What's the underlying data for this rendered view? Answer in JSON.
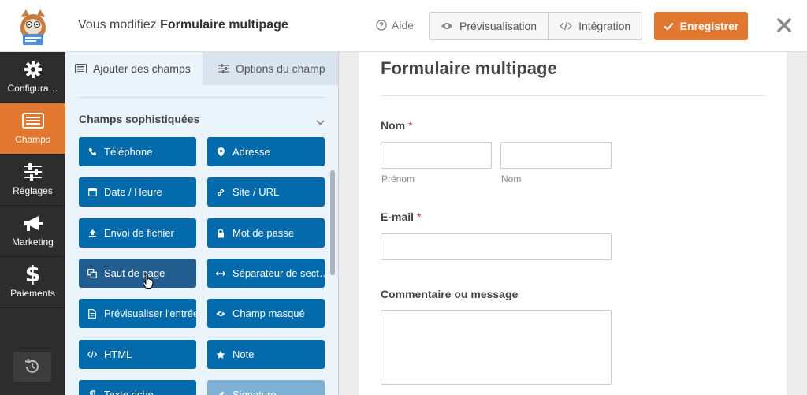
{
  "topbar": {
    "editing_prefix": "Vous modifiez ",
    "form_name": "Formulaire multipage",
    "help_label": "Aide",
    "preview_label": "Prévisualisation",
    "embed_label": "Intégration",
    "save_label": "Enregistrer"
  },
  "leftnav": {
    "items": [
      {
        "label": "Configura…",
        "icon": "gear-icon"
      },
      {
        "label": "Champs",
        "icon": "fields-icon"
      },
      {
        "label": "Réglages",
        "icon": "sliders-icon"
      },
      {
        "label": "Marketing",
        "icon": "megaphone-icon"
      },
      {
        "label": "Paiements",
        "icon": "dollar-icon"
      }
    ]
  },
  "panel": {
    "tab_add": "Ajouter des champs",
    "tab_options": "Options du champ",
    "section_title": "Champs sophistiquées",
    "fields": [
      {
        "label": "Téléphone",
        "icon": "phone-icon"
      },
      {
        "label": "Adresse",
        "icon": "map-pin-icon"
      },
      {
        "label": "Date / Heure",
        "icon": "calendar-icon"
      },
      {
        "label": "Site / URL",
        "icon": "link-icon"
      },
      {
        "label": "Envoi de fichier",
        "icon": "upload-icon"
      },
      {
        "label": "Mot de passe",
        "icon": "lock-icon"
      },
      {
        "label": "Saut de page",
        "icon": "copy-icon"
      },
      {
        "label": "Séparateur de sect…",
        "icon": "arrows-h-icon"
      },
      {
        "label": "Prévisualiser l'entrée",
        "icon": "file-icon"
      },
      {
        "label": "Champ masqué",
        "icon": "eye-slash-icon"
      },
      {
        "label": "HTML",
        "icon": "code-icon"
      },
      {
        "label": "Note",
        "icon": "star-icon"
      },
      {
        "label": "Texte riche",
        "icon": "paragraph-icon"
      },
      {
        "label": "Signature",
        "icon": "pen-icon"
      }
    ]
  },
  "preview": {
    "title": "Formulaire multipage",
    "name_label": "Nom",
    "required_mark": "*",
    "first_sub": "Prénom",
    "last_sub": "Nom",
    "email_label": "E-mail",
    "comment_label": "Commentaire ou message"
  },
  "colors": {
    "accent": "#e27730",
    "field_button": "#036aab",
    "nav_bg": "#2d2d2d",
    "panel_bg": "#ebf3fb"
  }
}
